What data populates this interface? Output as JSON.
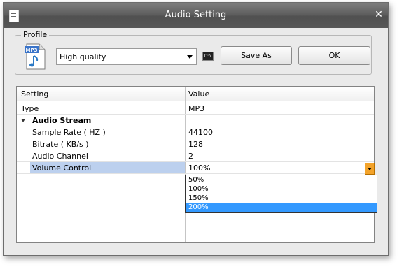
{
  "window": {
    "title": "Audio Setting",
    "close_glyph": "✕"
  },
  "profile": {
    "group_label": "Profile",
    "icon_label": "MP3",
    "selected": "High quality",
    "cmd_icon_text": "C:\\",
    "save_as_label": "Save As",
    "ok_label": "OK"
  },
  "grid": {
    "headers": {
      "setting": "Setting",
      "value": "Value"
    },
    "rows": [
      {
        "key": "Type",
        "value": "MP3"
      },
      {
        "key": "Audio Stream"
      },
      {
        "key": "Sample Rate ( HZ )",
        "value": "44100"
      },
      {
        "key": "Bitrate ( KB/s )",
        "value": "128"
      },
      {
        "key": "Audio Channel",
        "value": "2"
      },
      {
        "key": "Volume Control",
        "value": "100%"
      }
    ]
  },
  "dropdown": {
    "options": [
      "50%",
      "100%",
      "150%",
      "200%"
    ],
    "highlighted": "200%"
  },
  "colors": {
    "titlebar": "#5f5f5f",
    "selection": "#3399ff",
    "row_highlight": "#bcd0ee",
    "dropdown_button": "#f3a32a"
  },
  "icons": {
    "app": "document-icon",
    "profile": "mp3-file-icon",
    "cmd": "command-prompt-icon",
    "expander": "collapse-triangle-icon",
    "dropdown": "dropdown-arrow-icon"
  }
}
